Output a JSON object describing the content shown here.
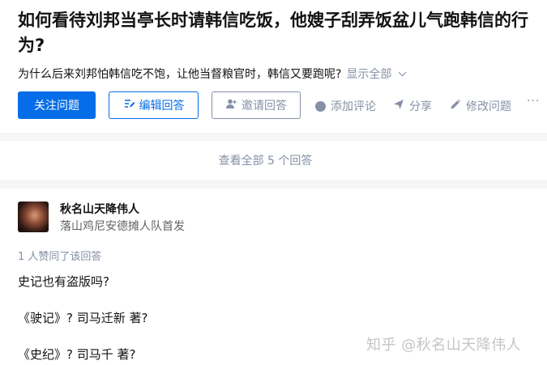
{
  "question": {
    "title": "如何看待刘邦当亭长时请韩信吃饭，他嫂子刮弄饭盆儿气跑韩信的行为?",
    "detail": "为什么后来刘邦怕韩信吃不饱，让他当督粮官时，韩信又要跑呢?",
    "show_all": "显示全部"
  },
  "actions": {
    "follow": "关注问题",
    "edit_answer": "编辑回答",
    "invite": "邀请回答",
    "comment": "添加评论",
    "share": "分享",
    "edit_question": "修改问题",
    "more": "···"
  },
  "view_all": "查看全部 5 个回答",
  "answer": {
    "author": "秋名山天降伟人",
    "bio": "落山鸡尼安德摊人队首发",
    "votes": "1 人赞同了该回答",
    "paragraphs": [
      "史记也有盗版吗?",
      "《驶记》?  司马迁新 著?",
      "《史纪》? 司马千 著?"
    ]
  },
  "watermark": "知乎 @秋名山天降伟人",
  "colors": {
    "brand_blue": "#056de8",
    "muted": "#8590a6"
  },
  "icons": [
    "edit-icon",
    "invite-icon",
    "comment-icon",
    "share-icon",
    "pencil-icon",
    "more-icon",
    "chevron-down-icon"
  ]
}
